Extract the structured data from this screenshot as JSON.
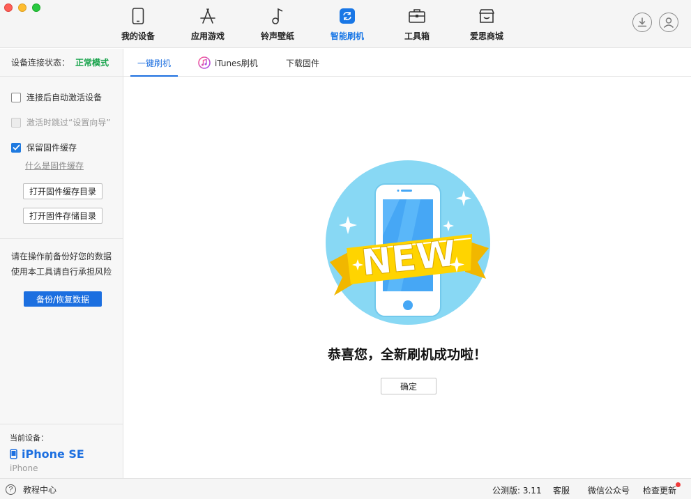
{
  "nav": {
    "items": [
      {
        "label": "我的设备",
        "icon": "phone-icon"
      },
      {
        "label": "应用游戏",
        "icon": "appstore-icon"
      },
      {
        "label": "铃声壁纸",
        "icon": "music-note-icon"
      },
      {
        "label": "智能刷机",
        "icon": "refresh-icon",
        "active": true
      },
      {
        "label": "工具箱",
        "icon": "toolbox-icon"
      },
      {
        "label": "爱思商城",
        "icon": "store-icon"
      }
    ],
    "accent_color": "#1977e6"
  },
  "sidebar": {
    "status_label": "设备连接状态：",
    "status_value": "正常模式",
    "options": [
      {
        "label": "连接后自动激活设备",
        "checked": false,
        "disabled": false
      },
      {
        "label": "激活时跳过“设置向导”",
        "checked": false,
        "disabled": true
      },
      {
        "label": "保留固件缓存",
        "checked": true,
        "disabled": false
      }
    ],
    "cache_link": "什么是固件缓存",
    "open_cache_dir": "打开固件缓存目录",
    "open_storage_dir": "打开固件存储目录",
    "warning_line1": "请在操作前备份好您的数据",
    "warning_line2": "使用本工具请自行承担风险",
    "backup_button": "备份/恢复数据",
    "current_device_label": "当前设备：",
    "device_name": "iPhone SE",
    "device_type": "iPhone"
  },
  "tabs": [
    {
      "label": "一键刷机",
      "active": true
    },
    {
      "label": "iTunes刷机"
    },
    {
      "label": "下载固件"
    }
  ],
  "main": {
    "badge_text": "NEW",
    "success_message": "恭喜您，全新刷机成功啦！",
    "confirm_button": "确定"
  },
  "statusbar": {
    "help": "教程中心",
    "version": "公测版: 3.11",
    "service": "客服",
    "wechat": "微信公众号",
    "update": "检查更新"
  }
}
